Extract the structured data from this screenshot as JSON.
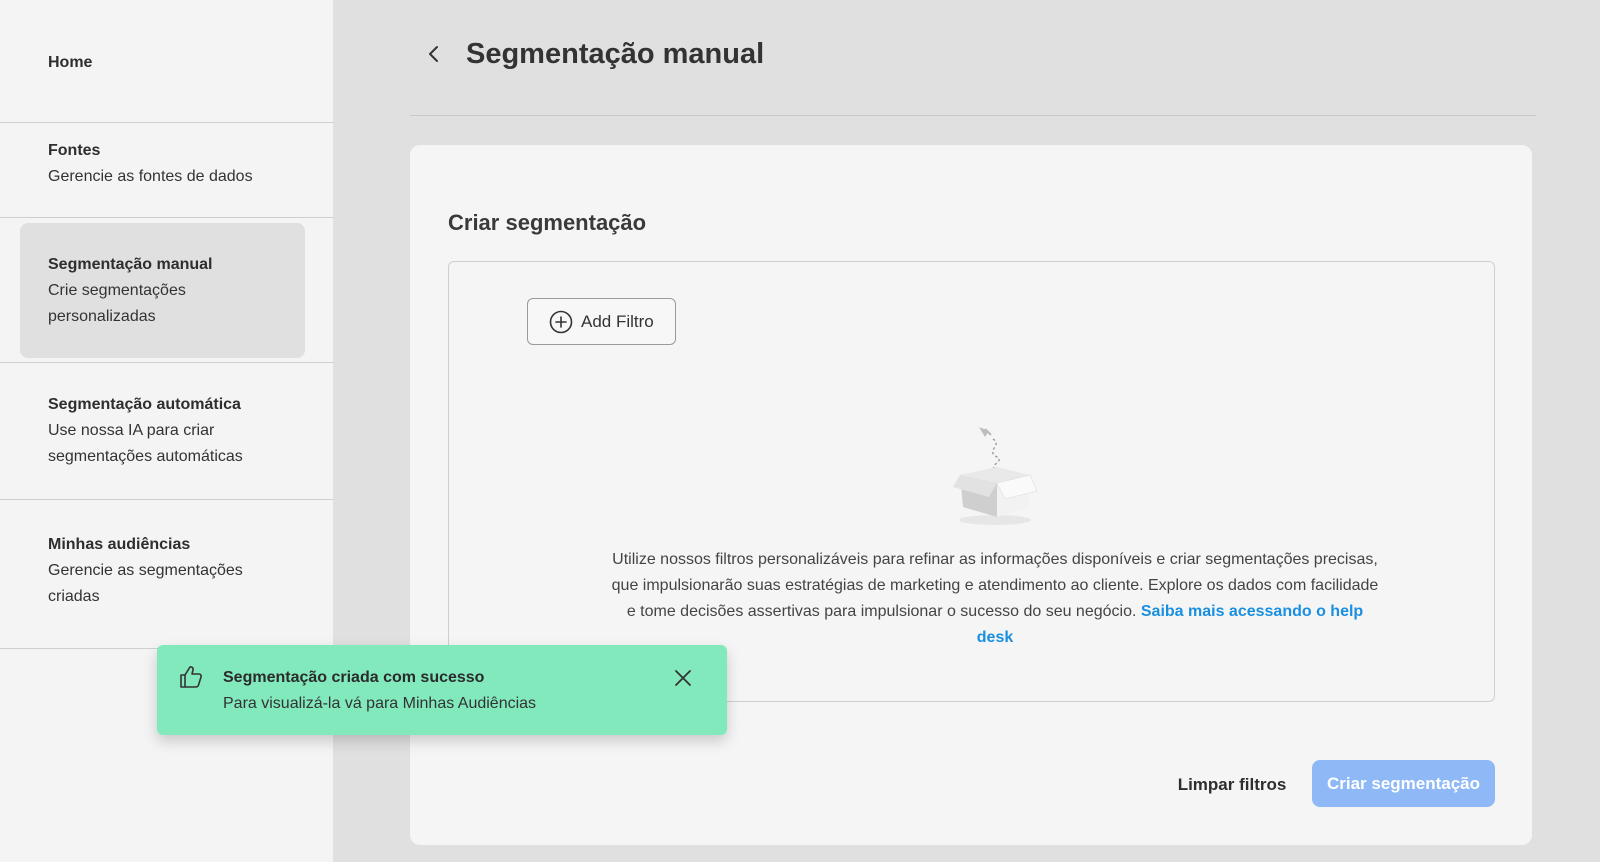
{
  "sidebar": {
    "items": [
      {
        "title": "Home",
        "desc": ""
      },
      {
        "title": "Fontes",
        "desc": "Gerencie as fontes de dados"
      },
      {
        "title": "Segmentação manual",
        "desc": "Crie segmentações personalizadas",
        "active": true
      },
      {
        "title": "Segmentação automática",
        "desc": "Use nossa IA para criar segmentações automáticas"
      },
      {
        "title": "Minhas audiências",
        "desc": "Gerencie as segmentações criadas"
      }
    ]
  },
  "header": {
    "title": "Segmentação manual",
    "back_icon": "chevron-left-icon"
  },
  "card": {
    "title": "Criar segmentação",
    "add_filter_label": "Add Filtro",
    "empty_text": "Utilize nossos filtros personalizáveis para refinar as informações disponíveis e criar segmentações precisas, que impulsionarão suas estratégias de marketing e atendimento ao cliente. Explore os dados com facilidade e tome decisões assertivas para impulsionar o sucesso do seu negócio.",
    "empty_link": "Saiba mais acessando o help desk",
    "clear_label": "Limpar filtros",
    "create_label": "Criar segmentação"
  },
  "toast": {
    "title": "Segmentação criada com sucesso",
    "message": "Para visualizá-la vá para Minhas Audiências",
    "icon": "thumbs-up-icon"
  },
  "colors": {
    "accent_link": "#1a8fe0",
    "create_button": "#8fb8f7",
    "toast_bg": "#82e9bd"
  }
}
